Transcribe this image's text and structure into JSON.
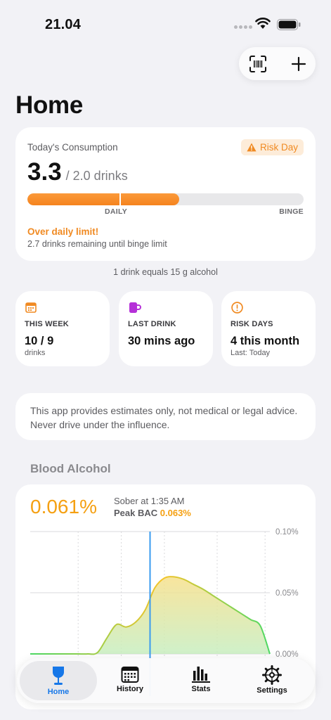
{
  "status_bar": {
    "time": "21.04"
  },
  "page": {
    "title": "Home"
  },
  "consumption": {
    "label": "Today's Consumption",
    "badge": "Risk Day",
    "value": "3.3",
    "limit": "/ 2.0 drinks",
    "progress_fraction": 0.55,
    "daily_label": "DAILY",
    "binge_label": "BINGE",
    "warning": "Over daily limit!",
    "remaining": "2.7 drinks remaining until binge limit"
  },
  "drink_note": "1 drink equals 15 g alcohol",
  "stats": [
    {
      "icon": "calendar-icon",
      "label": "THIS WEEK",
      "value": "10 / 9",
      "sub": "drinks"
    },
    {
      "icon": "mug-icon",
      "label": "LAST DRINK",
      "value": "30 mins ago",
      "sub": ""
    },
    {
      "icon": "alert-circle-icon",
      "label": "RISK DAYS",
      "value": "4 this month",
      "sub": "Last: Today"
    }
  ],
  "disclaimer": "This app provides estimates only, not medical or legal advice. Never drive under the influence.",
  "blood_alcohol": {
    "section_title": "Blood Alcohol",
    "current": "0.061%",
    "sober_at": "Sober at 1:35 AM",
    "peak_label": "Peak BAC",
    "peak_value": "0.063%"
  },
  "chart_data": {
    "type": "area",
    "x": [
      0,
      1,
      2,
      3,
      4,
      5,
      6,
      7,
      8,
      9,
      10,
      11,
      12,
      13,
      14,
      15,
      16,
      17,
      18,
      19,
      20,
      21,
      22,
      23,
      24,
      25
    ],
    "y": [
      0.0,
      0.0,
      0.0,
      0.0,
      0.0,
      0.0,
      0.0,
      0.001,
      0.013,
      0.024,
      0.022,
      0.026,
      0.036,
      0.054,
      0.062,
      0.063,
      0.061,
      0.057,
      0.053,
      0.048,
      0.043,
      0.038,
      0.033,
      0.028,
      0.023,
      0.0
    ],
    "y_ticks": [
      "0.10%",
      "0.05%",
      "0.00%"
    ],
    "ylim": [
      0,
      0.1
    ],
    "current_index": 12.5,
    "grid": true,
    "colors": {
      "line_start": "#4cd964",
      "line_peak": "#f5c42a",
      "current_marker": "#3a9bf0"
    }
  },
  "tabs": [
    {
      "icon": "wine-glass-icon",
      "label": "Home",
      "active": true
    },
    {
      "icon": "calendar-grid-icon",
      "label": "History",
      "active": false
    },
    {
      "icon": "bar-chart-icon",
      "label": "Stats",
      "active": false
    },
    {
      "icon": "gear-icon",
      "label": "Settings",
      "active": false
    }
  ]
}
